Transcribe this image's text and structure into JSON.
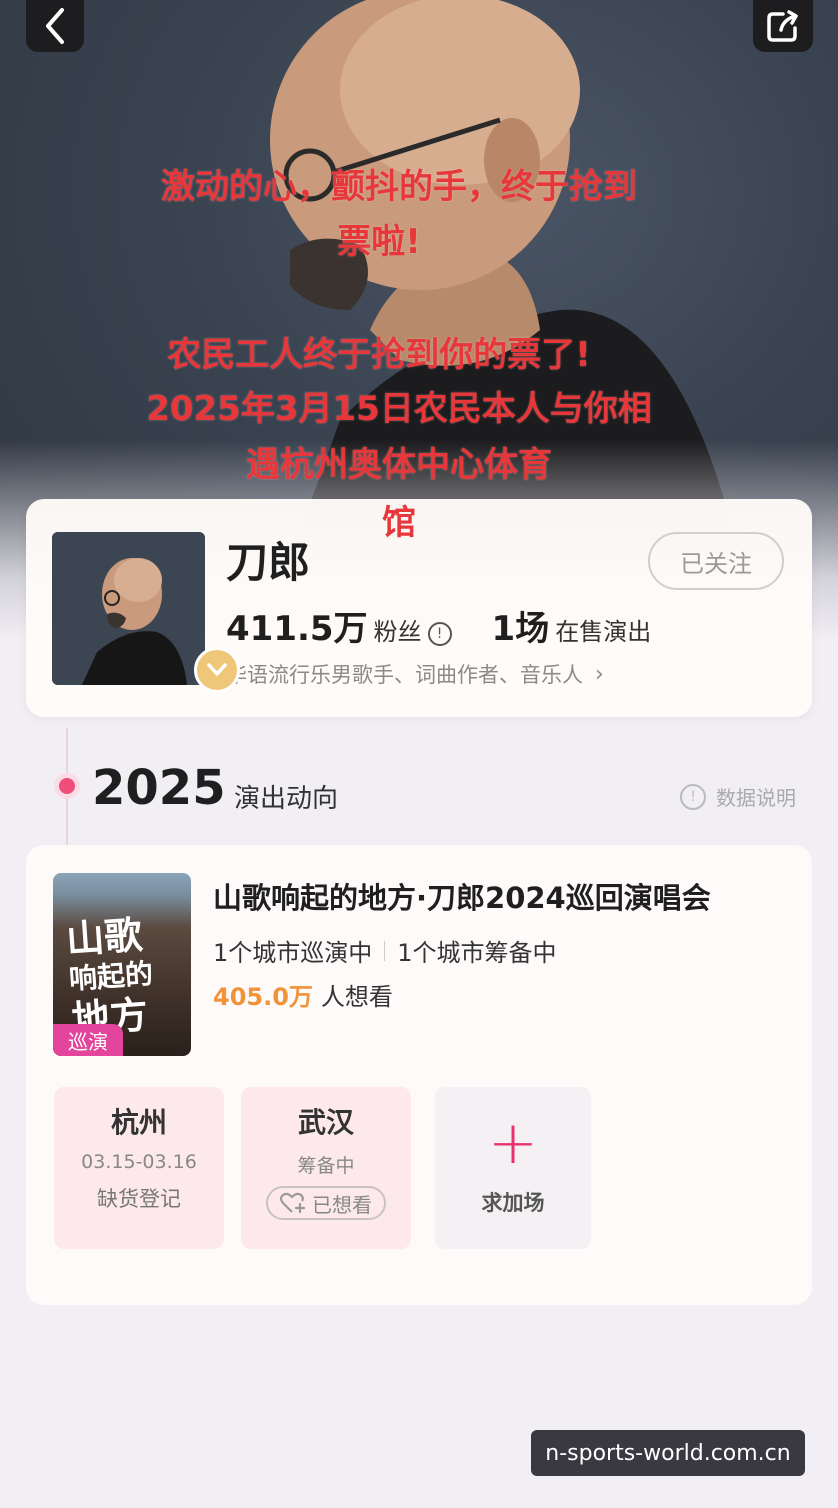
{
  "hero": {
    "overlay_lines": [
      "激动的心，颤抖的手，终于抢到",
      "票啦!",
      "农民工人终于抢到你的票了!",
      "2025年3月15日农民本人与你相",
      "遇杭州奥体中心体育",
      "馆"
    ]
  },
  "artist": {
    "name": "刀郎",
    "follow_label": "已关注",
    "fans_count": "411.5万",
    "fans_label": "粉丝",
    "shows_count": "1场",
    "shows_label": "在售演出",
    "tags": "华语流行乐男歌手、词曲作者、音乐人"
  },
  "timeline": {
    "year": "2025",
    "section_label": "演出动向",
    "data_note": "数据说明"
  },
  "tour": {
    "poster_text_lines": [
      "山歌",
      "响起的",
      "地方"
    ],
    "poster_badge": "巡演",
    "title": "山歌响起的地方·刀郎2024巡回演唱会",
    "cities_touring": "1个城市巡演中",
    "cities_preparing": "1个城市筹备中",
    "want_count": "405.0万",
    "want_label": "人想看",
    "city_cards": [
      {
        "name": "杭州",
        "date": "03.15-03.16",
        "status": "缺货登记"
      },
      {
        "name": "武汉",
        "status": "筹备中",
        "button": "已想看"
      }
    ],
    "add_show_label": "求加场"
  },
  "watermark": "n-sports-world.com.cn",
  "colors": {
    "overlay_red": "#e8373a",
    "accent_pink": "#e8316a",
    "want_orange": "#f0933b",
    "badge_magenta": "#e2459b"
  }
}
